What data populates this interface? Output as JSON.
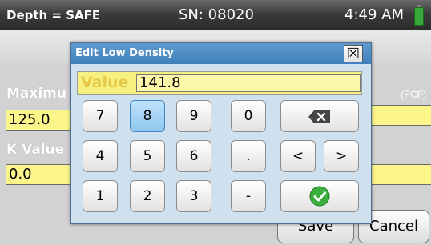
{
  "status": {
    "depth": "Depth = SAFE",
    "serial": "SN: 08020",
    "time": "4:49 AM"
  },
  "form": {
    "max_label": "Maximu",
    "max_value": "125.0",
    "unit": "(PCF)",
    "k_label": "K Value",
    "k_value": "0.0",
    "save_label": "Save",
    "cancel_label": "Cancel"
  },
  "dialog": {
    "title": "Edit Low Density",
    "close_glyph": "☒",
    "value_label": "Value",
    "value": "141.8",
    "keys": {
      "k7": "7",
      "k8": "8",
      "k9": "9",
      "k0": "0",
      "k4": "4",
      "k5": "5",
      "k6": "6",
      "dot": ".",
      "left": "<",
      "right": ">",
      "k1": "1",
      "k2": "2",
      "k3": "3",
      "minus": "-"
    },
    "pressed_key": "8"
  },
  "colors": {
    "accent": "#4a88c6",
    "field": "#fbf58a",
    "ok": "#3cae3c"
  }
}
